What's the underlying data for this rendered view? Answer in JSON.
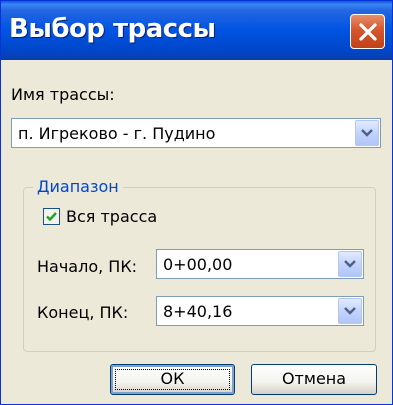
{
  "window": {
    "title": "Выбор трассы"
  },
  "route": {
    "label": "Имя трассы:",
    "selected": "п. Игреково - г. Пудино"
  },
  "range": {
    "legend": "Диапазон",
    "whole_route_label": "Вся трасса",
    "whole_route_checked": true,
    "start_label": "Начало, ПК:",
    "start_value": "0+00,00",
    "end_label": "Конец, ПК:",
    "end_value": "8+40,16"
  },
  "buttons": {
    "ok": "ОК",
    "cancel": "Отмена"
  },
  "colors": {
    "title_bar": "#0054e3",
    "close_button": "#d4572f",
    "legend_text": "#0046d5",
    "dialog_bg": "#ece9d8"
  }
}
